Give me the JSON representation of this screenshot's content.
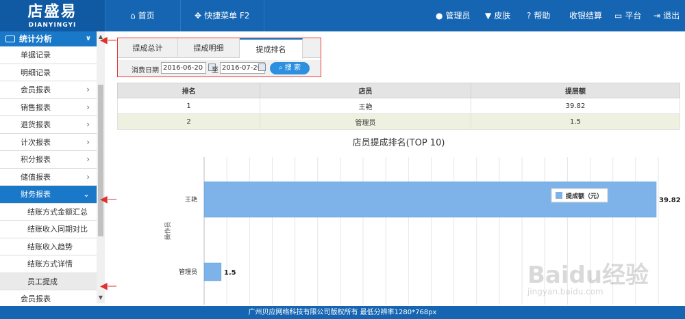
{
  "header": {
    "logo_main": "店盛易",
    "logo_sub": "DIANYINGYI",
    "nav_home": "首页",
    "nav_quick": "快捷菜单 F2",
    "nav_admin": "管理员",
    "nav_skin": "皮肤",
    "nav_help": "帮助",
    "nav_checkout": "收银结算",
    "nav_platform": "平台",
    "nav_logout": "退出"
  },
  "sidebar": {
    "section_title": "统计分析",
    "items": [
      {
        "label": "单据记录"
      },
      {
        "label": "明细记录"
      },
      {
        "label": "会员报表"
      },
      {
        "label": "销售报表"
      },
      {
        "label": "退货报表"
      },
      {
        "label": "计次报表"
      },
      {
        "label": "积分报表"
      },
      {
        "label": "储值报表"
      },
      {
        "label": "财务报表"
      }
    ],
    "sub_items": [
      {
        "label": "结账方式金额汇总"
      },
      {
        "label": "结账收入同期对比"
      },
      {
        "label": "结账收入趋势"
      },
      {
        "label": "结账方式详情"
      },
      {
        "label": "员工提成"
      }
    ],
    "cut_item": "会员报表"
  },
  "tabs": {
    "tab1": "提成总计",
    "tab2": "提成明细",
    "tab3": "提成排名"
  },
  "filter": {
    "label": "消费日期",
    "start": "2016-06-20",
    "to": "至",
    "end": "2016-07-20",
    "search": "搜 索"
  },
  "table": {
    "headers": [
      "排名",
      "店员",
      "提层额"
    ],
    "rows": [
      [
        "1",
        "王艳",
        "39.82"
      ],
      [
        "2",
        "管理员",
        "1.5"
      ]
    ]
  },
  "chart_data": {
    "type": "bar",
    "orientation": "horizontal",
    "title": "店员提成排名(TOP 10)",
    "ylabel": "操作员",
    "categories": [
      "王艳",
      "管理员"
    ],
    "series": [
      {
        "name": "提成额（元）",
        "values": [
          39.82,
          1.5
        ]
      }
    ],
    "data_labels": [
      "39.82",
      "1.5"
    ],
    "grid": true,
    "legend_position": "right",
    "color": "#7db3e8"
  },
  "footer": {
    "text": "广州贝应网络科技有限公司版权所有 最低分辨率1280*768px"
  },
  "watermark": {
    "main": "Baidu经验",
    "sub": "jingyan.baidu.com"
  }
}
